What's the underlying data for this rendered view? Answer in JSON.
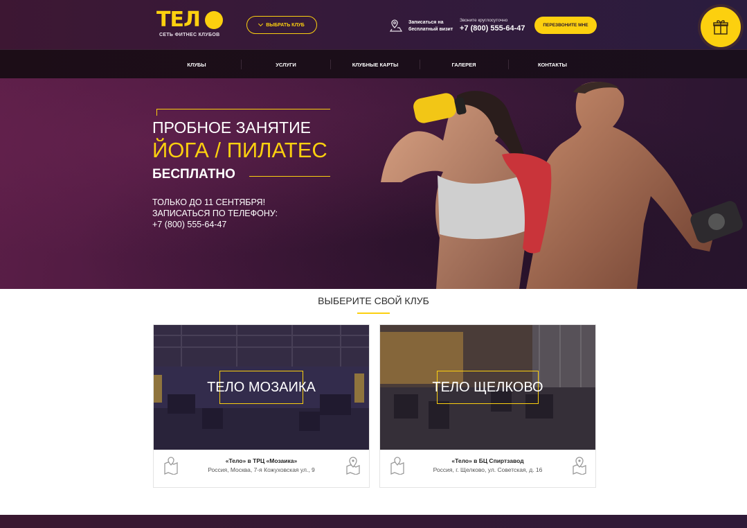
{
  "header": {
    "logo_text": "ТЕЛ",
    "logo_subtitle": "СЕТЬ ФИТНЕС КЛУБОВ",
    "club_select_label": "ВЫБРАТЬ КЛУБ",
    "free_visit_line1": "Записаться на",
    "free_visit_line2": "бесплатный визит",
    "phone_caption": "Звоните круглосуточно",
    "phone_number": "+7 (800) 555-64-47",
    "callback_label": "ПЕРЕЗВОНИТЕ МНЕ",
    "gift_icon": "gift-icon"
  },
  "nav": {
    "items": [
      {
        "label": "КЛУБЫ"
      },
      {
        "label": "УСЛУГИ"
      },
      {
        "label": "КЛУБНЫЕ КАРТЫ"
      },
      {
        "label": "ГАЛЕРЕЯ"
      },
      {
        "label": "КОНТАКТЫ"
      }
    ]
  },
  "hero": {
    "line1": "ПРОБНОЕ ЗАНЯТИЕ",
    "line2": "ЙОГА / ПИЛАТЕС",
    "line3": "БЕСПЛАТНО",
    "desc1": "ТОЛЬКО ДО 11 СЕНТЯБРЯ!",
    "desc2": "ЗАПИСАТЬСЯ ПО ТЕЛЕФОНУ:",
    "desc3": "+7 (800) 555-64-47"
  },
  "clubs": {
    "title": "ВЫБЕРИТЕ СВОЙ КЛУБ",
    "items": [
      {
        "name": "ТЕЛО МОЗАИКА",
        "place": "«Тело» в ТРЦ «Мозаика»",
        "address": "Россия, Москва, 7-я Кожуховская ул., 9"
      },
      {
        "name": "ТЕЛО ЩЕЛКОВО",
        "place": "«Тело» в БЦ Спиртзавод",
        "address": "Россия, г. Щелково, ул. Советская, д. 16"
      }
    ]
  },
  "colors": {
    "accent": "#fcd00f",
    "header_bg": "#3d1733",
    "nav_bg": "#1c0d17",
    "hero_bg": "#4a1a40"
  }
}
